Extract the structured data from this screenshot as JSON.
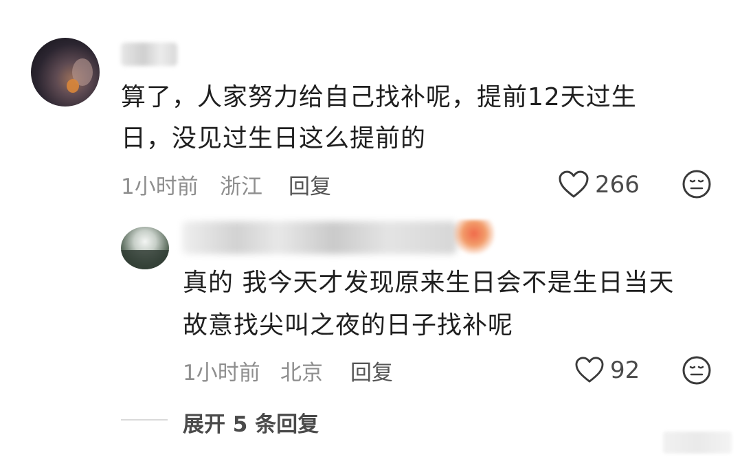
{
  "comments": [
    {
      "text_line1": "算了，人家努力给自己找补呢，提前12天过生",
      "text_line2": "日，没见过生日这么提前的",
      "time": "1小时前",
      "location": "浙江",
      "reply_label": "回复",
      "like_count": "266"
    },
    {
      "text_line1": "真的 我今天才发现原来生日会不是生日当天",
      "text_line2": "故意找尖叫之夜的日子找补呢",
      "time": "1小时前",
      "location": "北京",
      "reply_label": "回复",
      "like_count": "92"
    }
  ],
  "expand": {
    "label": "展开 5 条回复"
  },
  "icons": {
    "like": "heart-outline-icon",
    "dislike": "meh-face-icon"
  }
}
